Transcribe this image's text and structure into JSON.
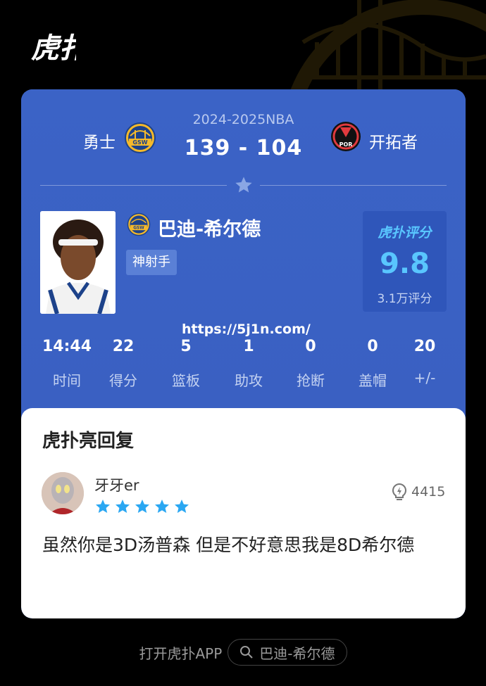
{
  "app": {
    "logo_text": "虎扑"
  },
  "match": {
    "season": "2024-2025NBA",
    "score": "139 - 104",
    "home_team": "勇士",
    "away_team": "开拓者",
    "home_logo_text": "GSW",
    "away_logo_text": "POR"
  },
  "player": {
    "name": "巴迪-希尔德",
    "tag": "神射手",
    "rating_brand": "虎扑评分",
    "rating": "9.8",
    "rating_count": "3.1万评分"
  },
  "watermark": "https://5j1n.com/",
  "stats": [
    {
      "value": "14:44",
      "label": "时间"
    },
    {
      "value": "22",
      "label": "得分"
    },
    {
      "value": "5",
      "label": "篮板"
    },
    {
      "value": "1",
      "label": "助攻"
    },
    {
      "value": "0",
      "label": "抢断"
    },
    {
      "value": "0",
      "label": "盖帽"
    },
    {
      "value": "20",
      "label": "+/-"
    }
  ],
  "reply": {
    "section_title": "虎扑亮回复",
    "username": "牙牙er",
    "stars": 5,
    "likes": "4415",
    "text": "虽然你是3D汤普森 但是不好意思我是8D希尔德"
  },
  "footer": {
    "open_app": "打开虎扑APP",
    "search": "巴迪-希尔德"
  },
  "colors": {
    "card_blue": "#3a62c4",
    "rating_cyan": "#59c6ff",
    "star_blue": "#2aa7f2"
  }
}
